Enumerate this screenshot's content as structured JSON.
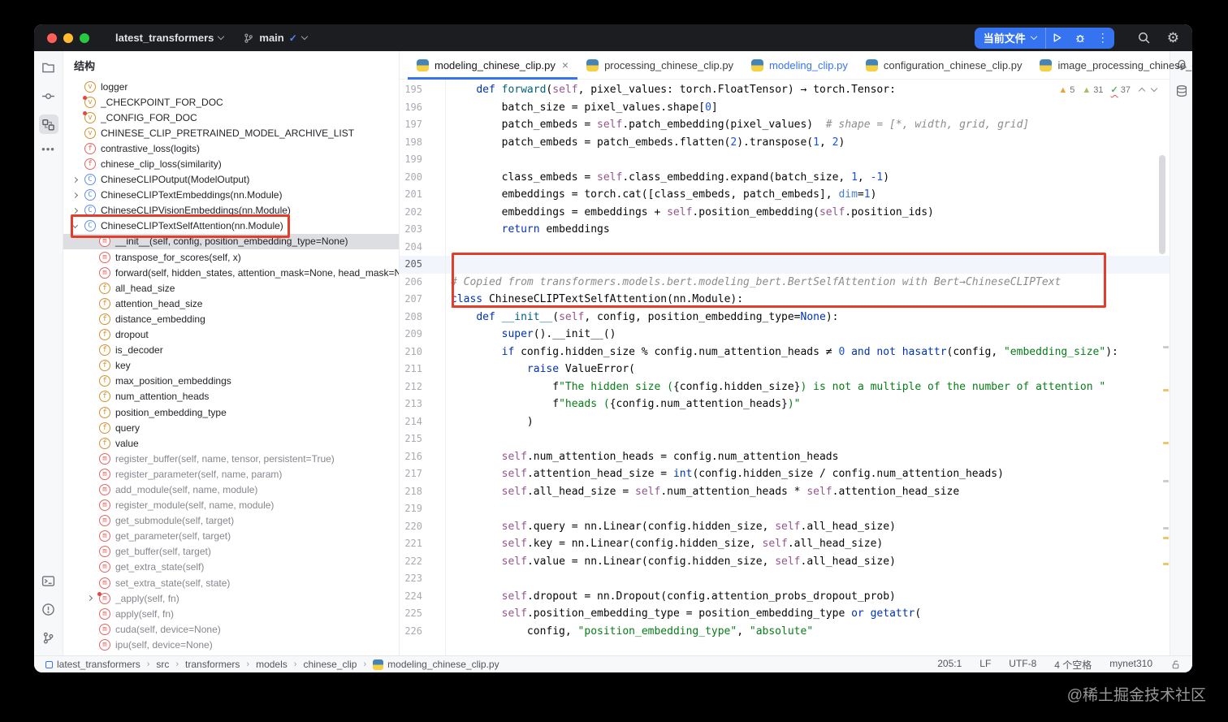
{
  "titlebar": {
    "project": "latest_transformers",
    "branch": "main",
    "run_target": "当前文件",
    "kebab": "⋮"
  },
  "panel": {
    "title": "结构"
  },
  "structure": {
    "items": [
      {
        "k": "var",
        "t": "logger"
      },
      {
        "k": "var",
        "dot": true,
        "t": "_CHECKPOINT_FOR_DOC"
      },
      {
        "k": "var",
        "dot": true,
        "t": "_CONFIG_FOR_DOC"
      },
      {
        "k": "var",
        "t": "CHINESE_CLIP_PRETRAINED_MODEL_ARCHIVE_LIST"
      },
      {
        "k": "func",
        "t": "contrastive_loss(logits)"
      },
      {
        "k": "func",
        "t": "chinese_clip_loss(similarity)"
      },
      {
        "k": "class",
        "chev": ">",
        "t": "ChineseCLIPOutput(ModelOutput)"
      },
      {
        "k": "class",
        "chev": ">",
        "t": "ChineseCLIPTextEmbeddings(nn.Module)"
      },
      {
        "k": "class",
        "chev": ">",
        "t": "ChineseCLIPVisionEmbeddings(nn.Module)"
      },
      {
        "k": "class",
        "chev": "v",
        "t": "ChineseCLIPTextSelfAttention(nn.Module)"
      },
      {
        "k": "method",
        "ind": 1,
        "sel": true,
        "t": "__init__(self, config, position_embedding_type=None)"
      },
      {
        "k": "method",
        "ind": 1,
        "t": "transpose_for_scores(self, x)"
      },
      {
        "k": "method",
        "ind": 1,
        "t": "forward(self, hidden_states, attention_mask=None, head_mask=None, en"
      },
      {
        "k": "field",
        "ind": 1,
        "t": "all_head_size"
      },
      {
        "k": "field",
        "ind": 1,
        "t": "attention_head_size"
      },
      {
        "k": "field",
        "ind": 1,
        "t": "distance_embedding"
      },
      {
        "k": "field",
        "ind": 1,
        "t": "dropout"
      },
      {
        "k": "field",
        "ind": 1,
        "t": "is_decoder"
      },
      {
        "k": "field",
        "ind": 1,
        "t": "key"
      },
      {
        "k": "field",
        "ind": 1,
        "t": "max_position_embeddings"
      },
      {
        "k": "field",
        "ind": 1,
        "t": "num_attention_heads"
      },
      {
        "k": "field",
        "ind": 1,
        "t": "position_embedding_type"
      },
      {
        "k": "field",
        "ind": 1,
        "t": "query"
      },
      {
        "k": "field",
        "ind": 1,
        "t": "value"
      },
      {
        "k": "method",
        "ind": 1,
        "gray": true,
        "t": "register_buffer(self, name, tensor, persistent=True)"
      },
      {
        "k": "method",
        "ind": 1,
        "gray": true,
        "t": "register_parameter(self, name, param)"
      },
      {
        "k": "method",
        "ind": 1,
        "gray": true,
        "t": "add_module(self, name, module)"
      },
      {
        "k": "method",
        "ind": 1,
        "gray": true,
        "t": "register_module(self, name, module)"
      },
      {
        "k": "method",
        "ind": 1,
        "gray": true,
        "t": "get_submodule(self, target)"
      },
      {
        "k": "method",
        "ind": 1,
        "gray": true,
        "t": "get_parameter(self, target)"
      },
      {
        "k": "method",
        "ind": 1,
        "gray": true,
        "t": "get_buffer(self, target)"
      },
      {
        "k": "method",
        "ind": 1,
        "gray": true,
        "t": "get_extra_state(self)"
      },
      {
        "k": "method",
        "ind": 1,
        "gray": true,
        "t": "set_extra_state(self, state)"
      },
      {
        "k": "method",
        "dot": true,
        "chev": ">",
        "ind": 1,
        "gray": true,
        "t": "_apply(self, fn)"
      },
      {
        "k": "method",
        "ind": 1,
        "gray": true,
        "t": "apply(self, fn)"
      },
      {
        "k": "method",
        "ind": 1,
        "gray": true,
        "t": "cuda(self, device=None)"
      },
      {
        "k": "method",
        "ind": 1,
        "gray": true,
        "t": "ipu(self, device=None)"
      }
    ]
  },
  "tabs": [
    {
      "label": "modeling_chinese_clip.py",
      "active": true,
      "close": "×"
    },
    {
      "label": "processing_chinese_clip.py"
    },
    {
      "label": "modeling_clip.py",
      "hl": true
    },
    {
      "label": "configuration_chinese_clip.py"
    },
    {
      "label": "image_processing_chinese_clip.py"
    }
  ],
  "inspections": {
    "warnings": "5",
    "weak_warnings": "31",
    "typos": "37"
  },
  "editor": {
    "lines": [
      {
        "n": 195,
        "seg": [
          [
            "d",
            "    "
          ],
          [
            "k",
            "def "
          ],
          [
            "f",
            "forward"
          ],
          [
            "d",
            "("
          ],
          [
            "s",
            "self"
          ],
          [
            "d",
            ", pixel_values: torch.FloatTensor) → torch.Tensor:"
          ]
        ]
      },
      {
        "n": 196,
        "seg": [
          [
            "d",
            "        batch_size = pixel_values.shape["
          ],
          [
            "n",
            "0"
          ],
          [
            "d",
            "]"
          ]
        ]
      },
      {
        "n": 197,
        "seg": [
          [
            "d",
            "        patch_embeds = "
          ],
          [
            "s",
            "self"
          ],
          [
            "d",
            ".patch_embedding(pixel_values)  "
          ],
          [
            "c",
            "# shape = [*, width, grid, grid]"
          ]
        ]
      },
      {
        "n": 198,
        "seg": [
          [
            "d",
            "        patch_embeds = patch_embeds.flatten("
          ],
          [
            "n",
            "2"
          ],
          [
            "d",
            ").transpose("
          ],
          [
            "n",
            "1"
          ],
          [
            "d",
            ", "
          ],
          [
            "n",
            "2"
          ],
          [
            "d",
            ")"
          ]
        ]
      },
      {
        "n": 199,
        "seg": []
      },
      {
        "n": 200,
        "seg": [
          [
            "d",
            "        class_embeds = "
          ],
          [
            "s",
            "self"
          ],
          [
            "d",
            ".class_embedding.expand(batch_size, "
          ],
          [
            "n",
            "1"
          ],
          [
            "d",
            ", "
          ],
          [
            "n",
            "-1"
          ],
          [
            "d",
            ")"
          ]
        ]
      },
      {
        "n": 201,
        "seg": [
          [
            "d",
            "        embeddings = torch.cat([class_embeds, patch_embeds], "
          ],
          [
            "kw",
            "dim"
          ],
          [
            "d",
            "="
          ],
          [
            "n",
            "1"
          ],
          [
            "d",
            ")"
          ]
        ]
      },
      {
        "n": 202,
        "seg": [
          [
            "d",
            "        embeddings = embeddings + "
          ],
          [
            "s",
            "self"
          ],
          [
            "d",
            ".position_embedding("
          ],
          [
            "s",
            "self"
          ],
          [
            "d",
            ".position_ids)"
          ]
        ]
      },
      {
        "n": 203,
        "seg": [
          [
            "d",
            "        "
          ],
          [
            "k",
            "return"
          ],
          [
            "d",
            " embeddings"
          ]
        ]
      },
      {
        "n": 204,
        "seg": []
      },
      {
        "n": 205,
        "cur": true,
        "seg": []
      },
      {
        "n": 206,
        "seg": [
          [
            "c",
            "# Copied from transformers.models.bert.modeling_bert.BertSelfAttention with Bert→ChineseCLIPText"
          ]
        ]
      },
      {
        "n": 207,
        "seg": [
          [
            "k wavy",
            "class "
          ],
          [
            "d wavy",
            "ChineseCLIPTextSelfAttention"
          ],
          [
            "d",
            "(nn.Module):"
          ]
        ]
      },
      {
        "n": 208,
        "seg": [
          [
            "d",
            "    "
          ],
          [
            "k",
            "def "
          ],
          [
            "f",
            "__init__"
          ],
          [
            "d",
            "("
          ],
          [
            "s",
            "self"
          ],
          [
            "d",
            ", config, position_embedding_type="
          ],
          [
            "k",
            "None"
          ],
          [
            "d",
            "):"
          ]
        ]
      },
      {
        "n": 209,
        "seg": [
          [
            "d",
            "        "
          ],
          [
            "k",
            "super"
          ],
          [
            "d",
            "().__init__()"
          ]
        ]
      },
      {
        "n": 210,
        "seg": [
          [
            "d",
            "        "
          ],
          [
            "k",
            "if"
          ],
          [
            "d",
            " config.hidden_size % config.num_attention_heads ≠ "
          ],
          [
            "n",
            "0"
          ],
          [
            "d",
            " "
          ],
          [
            "k",
            "and"
          ],
          [
            "d",
            " "
          ],
          [
            "k",
            "not"
          ],
          [
            "d",
            " "
          ],
          [
            "k",
            "hasattr"
          ],
          [
            "d",
            "(config, "
          ],
          [
            "st",
            "\"embedding_size\""
          ],
          [
            "d",
            "):"
          ]
        ]
      },
      {
        "n": 211,
        "seg": [
          [
            "d",
            "            "
          ],
          [
            "k",
            "raise"
          ],
          [
            "d",
            " ValueError("
          ]
        ]
      },
      {
        "n": 212,
        "seg": [
          [
            "d",
            "                f"
          ],
          [
            "st",
            "\"The hidden size ("
          ],
          [
            "d",
            "{config.hidden_size}"
          ],
          [
            "st",
            ") is not a multiple of the number of attention \""
          ]
        ]
      },
      {
        "n": 213,
        "seg": [
          [
            "d",
            "                f"
          ],
          [
            "st",
            "\"heads ("
          ],
          [
            "d",
            "{config.num_attention_heads}"
          ],
          [
            "st",
            ")\""
          ]
        ]
      },
      {
        "n": 214,
        "seg": [
          [
            "d",
            "            )"
          ]
        ]
      },
      {
        "n": 215,
        "seg": []
      },
      {
        "n": 216,
        "seg": [
          [
            "d",
            "        "
          ],
          [
            "s",
            "self"
          ],
          [
            "d",
            ".num_attention_heads = config.num_attention_heads"
          ]
        ]
      },
      {
        "n": 217,
        "seg": [
          [
            "d",
            "        "
          ],
          [
            "s",
            "self"
          ],
          [
            "d",
            ".attention_head_size = "
          ],
          [
            "k",
            "int"
          ],
          [
            "d",
            "(config.hidden_size / config.num_attention_heads)"
          ]
        ]
      },
      {
        "n": 218,
        "seg": [
          [
            "d",
            "        "
          ],
          [
            "s",
            "self"
          ],
          [
            "d",
            ".all_head_size = "
          ],
          [
            "s",
            "self"
          ],
          [
            "d",
            ".num_attention_heads * "
          ],
          [
            "s",
            "self"
          ],
          [
            "d",
            ".attention_head_size"
          ]
        ]
      },
      {
        "n": 219,
        "seg": []
      },
      {
        "n": 220,
        "seg": [
          [
            "d",
            "        "
          ],
          [
            "s",
            "self"
          ],
          [
            "d",
            ".query = nn.Linear(config.hidden_size, "
          ],
          [
            "s",
            "self"
          ],
          [
            "d",
            ".all_head_size)"
          ]
        ]
      },
      {
        "n": 221,
        "seg": [
          [
            "d",
            "        "
          ],
          [
            "s",
            "self"
          ],
          [
            "d",
            ".key = nn.Linear(config.hidden_size, "
          ],
          [
            "s",
            "self"
          ],
          [
            "d",
            ".all_head_size)"
          ]
        ]
      },
      {
        "n": 222,
        "seg": [
          [
            "d",
            "        "
          ],
          [
            "s",
            "self"
          ],
          [
            "d",
            ".value = nn.Linear(config.hidden_size, "
          ],
          [
            "s",
            "self"
          ],
          [
            "d",
            ".all_head_size)"
          ]
        ]
      },
      {
        "n": 223,
        "seg": []
      },
      {
        "n": 224,
        "seg": [
          [
            "d",
            "        "
          ],
          [
            "s",
            "self"
          ],
          [
            "d",
            ".dropout = nn.Dropout(config.attention_probs_dropout_prob)"
          ]
        ]
      },
      {
        "n": 225,
        "seg": [
          [
            "d",
            "        "
          ],
          [
            "s",
            "self"
          ],
          [
            "d",
            ".position_embedding_type = position_embedding_type "
          ],
          [
            "k",
            "or"
          ],
          [
            "d",
            " "
          ],
          [
            "k",
            "getattr"
          ],
          [
            "d",
            "("
          ]
        ]
      },
      {
        "n": 226,
        "seg": [
          [
            "d",
            "            config, "
          ],
          [
            "st",
            "\"position_embedding_type\""
          ],
          [
            "d",
            ", "
          ],
          [
            "st",
            "\"absolute\""
          ]
        ]
      }
    ]
  },
  "statusbar": {
    "breadcrumbs": [
      "latest_transformers",
      "src",
      "transformers",
      "models",
      "chinese_clip",
      "modeling_chinese_clip.py"
    ],
    "right_items": [
      "205:1",
      "LF",
      "UTF-8",
      "4 个空格",
      "mynet310"
    ]
  },
  "annotations": {
    "color": "#e23e2b",
    "targets": [
      "structure-item-chineseclip-text-self-attention",
      "editor-lines-205-207"
    ]
  },
  "watermark": "@稀土掘金技术社区"
}
